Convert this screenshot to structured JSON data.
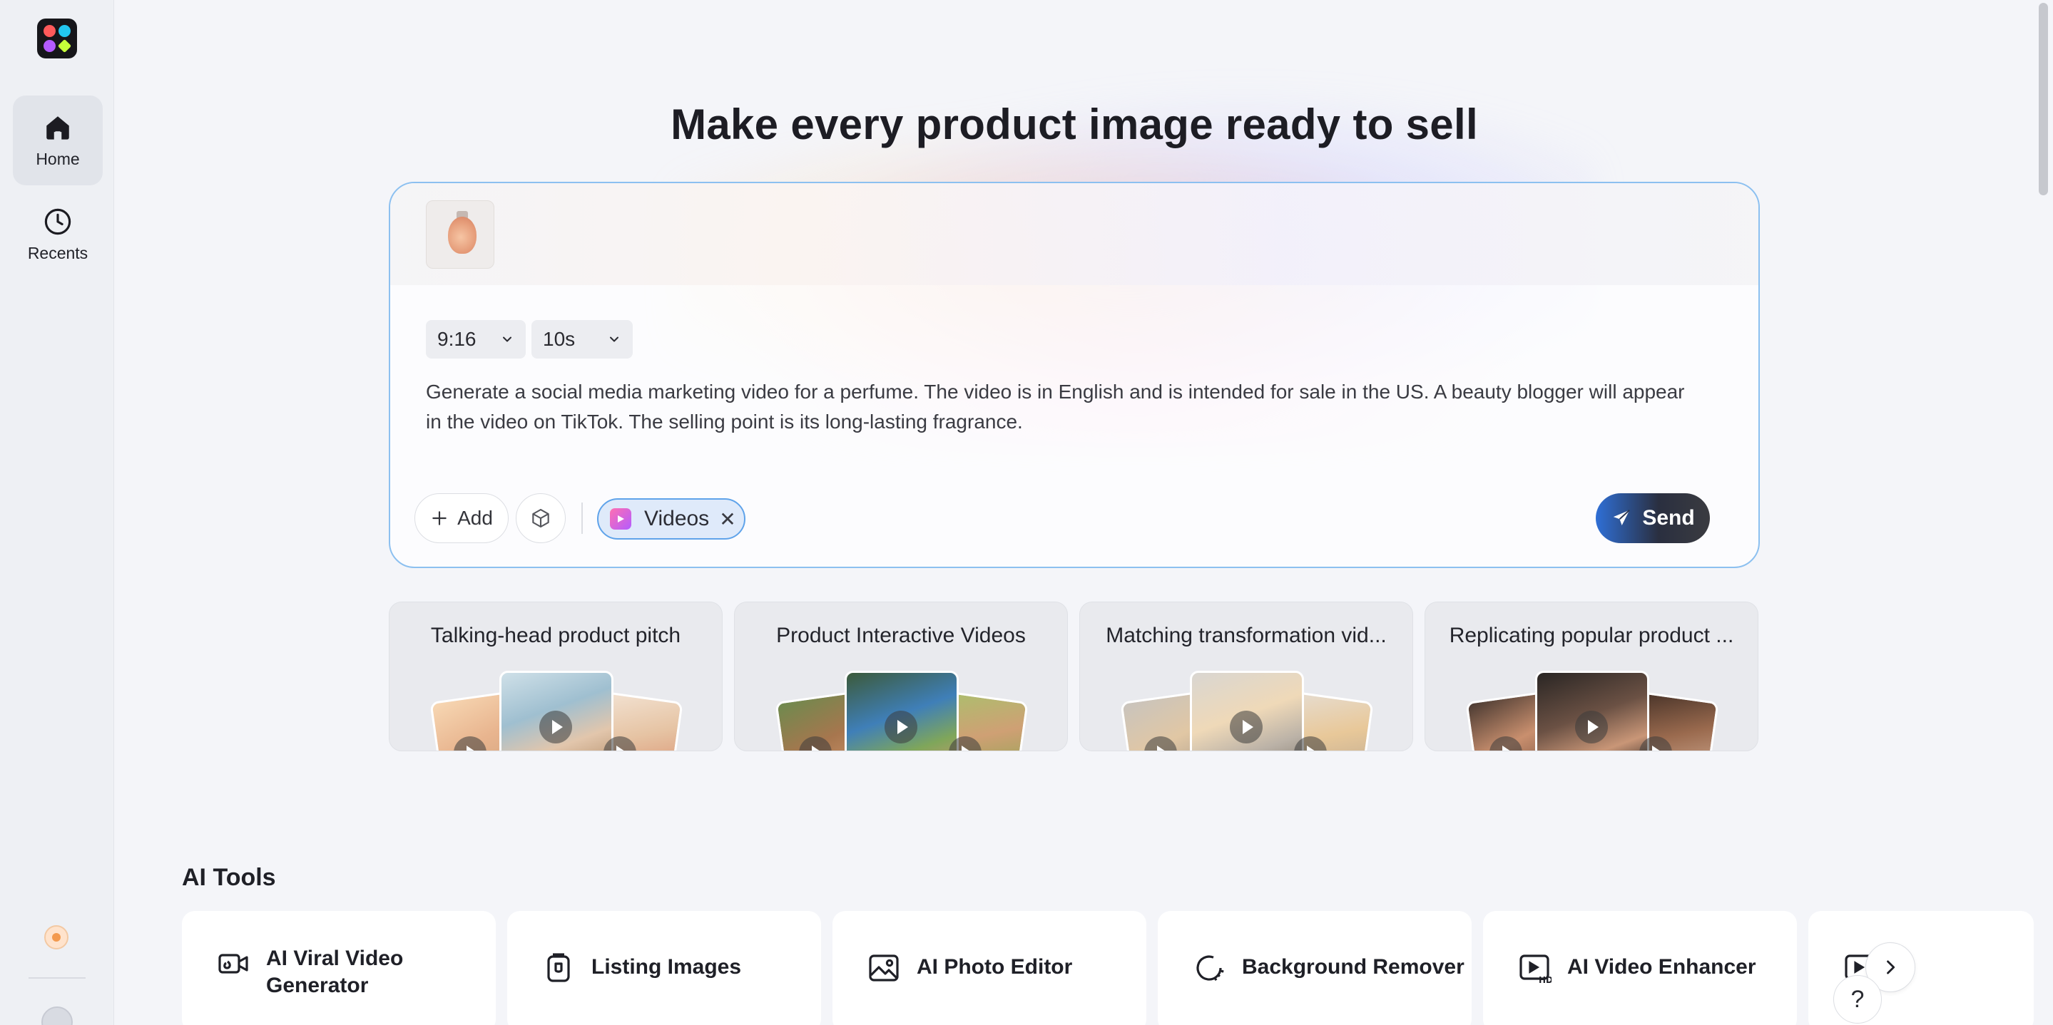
{
  "sidebar": {
    "items": [
      {
        "label": "Home",
        "icon": "home-icon",
        "active": true
      },
      {
        "label": "Recents",
        "icon": "clock-icon",
        "active": false
      }
    ]
  },
  "hero": {
    "title": "Make every product image ready to sell"
  },
  "composer": {
    "aspect_ratio": "9:16",
    "duration": "10s",
    "prompt": "Generate a social media marketing video for a perfume. The video is in English and is intended for sale in the US. A beauty blogger will appear in the video on TikTok. The selling point is its long-lasting fragrance.",
    "add_label": "Add",
    "chip_label": "Videos",
    "chip_close": "✕",
    "send_label": "Send"
  },
  "templates": [
    {
      "title": "Talking-head product pitch"
    },
    {
      "title": "Product Interactive Videos"
    },
    {
      "title": "Matching transformation vid..."
    },
    {
      "title": "Replicating popular product ..."
    }
  ],
  "tools": {
    "section_title": "AI Tools",
    "items": [
      {
        "label": "AI Viral Video Generator",
        "icon": "video-camera-icon"
      },
      {
        "label": "Listing Images",
        "icon": "listing-images-icon"
      },
      {
        "label": "AI Photo Editor",
        "icon": "photo-icon"
      },
      {
        "label": "Background Remover",
        "icon": "background-remover-icon"
      },
      {
        "label": "AI Video Enhancer",
        "icon": "hd-video-icon"
      }
    ]
  },
  "help": {
    "label": "?"
  },
  "colors": {
    "accent_blue": "#5fa3ea",
    "sidebar_bg": "#eef0f4",
    "page_bg": "#f4f5f9"
  }
}
